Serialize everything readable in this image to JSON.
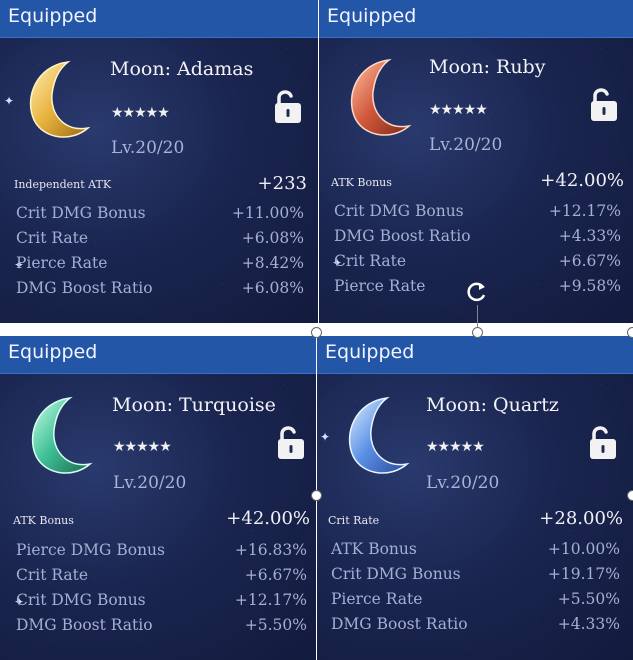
{
  "cards": [
    {
      "header": "Equipped",
      "name": "Moon: Adamas",
      "stars": "★★★★★",
      "level": "Lv.20/20",
      "main_stat": {
        "label": "Independent ATK",
        "value": "+233"
      },
      "sub_stats": [
        {
          "label": "Crit DMG Bonus",
          "value": "+11.00%"
        },
        {
          "label": "Crit Rate",
          "value": "+6.08%"
        },
        {
          "label": "Pierce Rate",
          "value": "+8.42%"
        },
        {
          "label": "DMG Boost Ratio",
          "value": "+6.08%"
        }
      ],
      "moon_color": "#e8b23c"
    },
    {
      "header": "Equipped",
      "name": "Moon: Ruby",
      "stars": "★★★★★",
      "level": "Lv.20/20",
      "main_stat": {
        "label": "ATK Bonus",
        "value": "+42.00%"
      },
      "sub_stats": [
        {
          "label": "Crit DMG Bonus",
          "value": "+12.17%"
        },
        {
          "label": "DMG Boost Ratio",
          "value": "+4.33%"
        },
        {
          "label": "Crit Rate",
          "value": "+6.67%"
        },
        {
          "label": "Pierce Rate",
          "value": "+9.58%"
        }
      ],
      "moon_color": "#d2583c"
    },
    {
      "header": "Equipped",
      "name": "Moon: Turquoise",
      "stars": "★★★★★",
      "level": "Lv.20/20",
      "main_stat": {
        "label": "ATK Bonus",
        "value": "+42.00%"
      },
      "sub_stats": [
        {
          "label": "Pierce DMG Bonus",
          "value": "+16.83%"
        },
        {
          "label": "Crit Rate",
          "value": "+6.67%"
        },
        {
          "label": "Crit DMG Bonus",
          "value": "+12.17%"
        },
        {
          "label": "DMG Boost Ratio",
          "value": "+5.50%"
        }
      ],
      "moon_color": "#3fbf95"
    },
    {
      "header": "Equipped",
      "name": "Moon: Quartz",
      "stars": "★★★★★",
      "level": "Lv.20/20",
      "main_stat": {
        "label": "Crit Rate",
        "value": "+28.00%"
      },
      "sub_stats": [
        {
          "label": "ATK Bonus",
          "value": "+10.00%"
        },
        {
          "label": "Crit DMG Bonus",
          "value": "+19.17%"
        },
        {
          "label": "Pierce Rate",
          "value": "+5.50%"
        },
        {
          "label": "DMG Boost Ratio",
          "value": "+4.33%"
        }
      ],
      "moon_color": "#5a8fe6"
    }
  ]
}
